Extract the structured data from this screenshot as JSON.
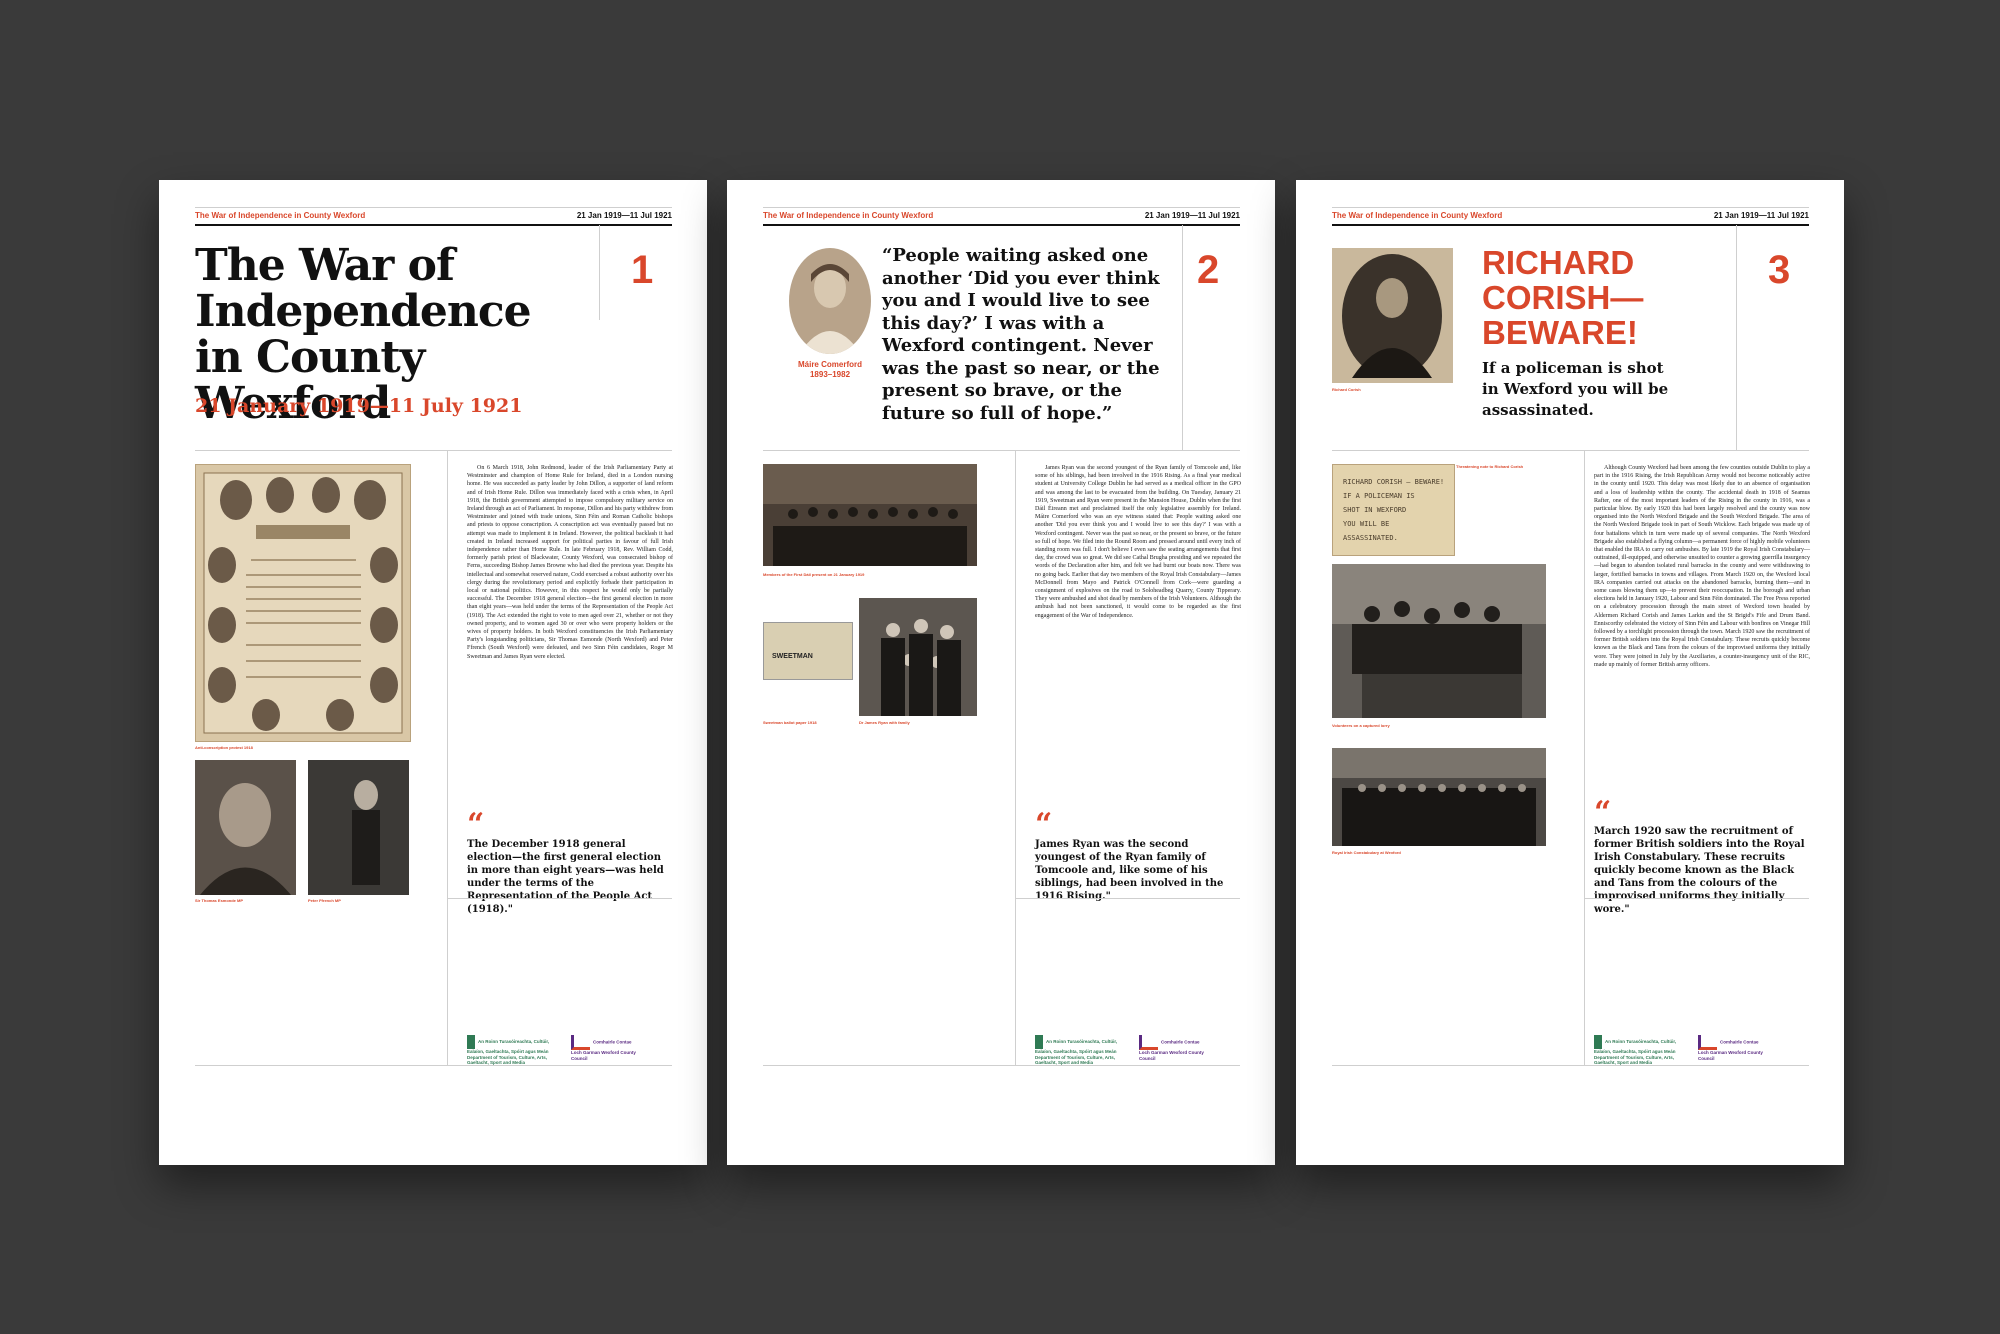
{
  "header": {
    "series_title": "The War of Independence in County Wexford",
    "date_range": "21 Jan 1919—11 Jul 1921"
  },
  "panel1": {
    "number": "1",
    "title": "The War of Independence in County Wexford",
    "subtitle": "21 January 1919—11 July 1921",
    "body": "On 6 March 1918, John Redmond, leader of the Irish Parliamentary Party at Westminster and champion of Home Rule for Ireland, died in a London nursing home. He was succeeded as party leader by John Dillon, a supporter of land reform and of Irish Home Rule. Dillon was immediately faced with a crisis when, in April 1918, the British government attempted to impose compulsory military service on Ireland through an act of Parliament. In response, Dillon and his party withdrew from Westminster and joined with trade unions, Sinn Féin and Roman Catholic bishops and priests to oppose conscription. A conscription act was eventually passed but no attempt was made to implement it in Ireland. However, the political backlash it had created in Ireland increased support for political parties in favour of full Irish independence rather than Home Rule. In late February 1918, Rev. William Codd, formerly parish priest of Blackwater, County Wexford, was consecrated bishop of Ferns, succeeding Bishop James Browne who had died the previous year. Despite his intellectual and somewhat reserved nature, Codd exercised a robust authority over his clergy during the revolutionary period and explicitly forbade their participation in local or national politics. However, in this respect he would only be partially successful. The December 1918 general election—the first general election in more than eight years—was held under the terms of the Representation of the People Act (1918). The Act extended the right to vote to men aged over 21, whether or not they owned property, and to women aged 30 or over who were property holders or the wives of property holders. In both Wexford constituencies the Irish Parliamentary Party's longstanding politicians, Sir Thomas Esmonde (North Wexford) and Peter Ffrench (South Wexford) were defeated, and two Sinn Féin candidates, Roger M Sweetman and James Ryan were elected.",
    "pullquote": "The December 1918 general election—the first general election in more than eight years—was held under the terms of the Representation of the People Act (1918).\"",
    "captions": [
      "Anti-conscription protest 1918",
      "Sir Thomas Esmonde MP",
      "Peter Ffrench MP"
    ]
  },
  "panel2": {
    "number": "2",
    "portrait_name": "Máire Comerford",
    "portrait_years": "1893–1982",
    "quote": "“People waiting asked one another ‘Did you ever think you and I would live to see this day?’ I was with a Wexford contingent. Never was the past so near, or the present so brave, or the future so full of hope.”",
    "body": "James Ryan was the second youngest of the Ryan family of Tomcoole and, like some of his siblings, had been involved in the 1916 Rising. As a final year medical student at University College Dublin he had served as a medical officer in the GPO and was among the last to be evacuated from the building. On Tuesday, January 21 1919, Sweetman and Ryan were present in the Mansion House, Dublin when the first Dáil Éireann met and proclaimed itself the only legislative assembly for Ireland. Máire Comerford who was an eye witness stated that: People waiting asked one another 'Did you ever think you and I would live to see this day?' I was with a Wexford contingent. Never was the past so near, or the present so brave, or the future so full of hope. We filed into the Round Room and pressed around until every inch of standing room was full. I don't believe I even saw the seating arrangements that first day, the crowd was so great. We did see Cathal Brugha presiding and we repeated the words of the Declaration after him, and felt we had burnt our boats now. There was no going back. Earlier that day two members of the Royal Irish Constabulary—James McDonnell from Mayo and Patrick O'Connell from Cork—were guarding a consignment of explosives on the road to Soloheadbeg Quarry, County Tipperary. They were ambushed and shot dead by members of the Irish Volunteers. Although the ambush had not been sanctioned, it would come to be regarded as the first engagement of the War of Independence.",
    "pullquote": "James Ryan was the second youngest of the Ryan family of Tomcoole and, like some of his siblings, had been involved in the 1916 Rising.\"",
    "ballot_text": "SWEETMAN",
    "captions": [
      "Members of the First Dáil present on 21 January 1919",
      "Sweetman ballot paper 1918",
      "Dr James Ryan with family"
    ]
  },
  "panel3": {
    "number": "3",
    "title": "RICHARD CORISH—BEWARE!",
    "subtitle": "If a policeman is shot in Wexford you will be assassinated.",
    "note_lines": [
      "RICHARD CORISH — BEWARE!",
      "IF A POLICEMAN IS",
      "SHOT IN WEXFORD",
      "YOU WILL BE",
      "ASSASSINATED."
    ],
    "body": "Although County Wexford had been among the few counties outside Dublin to play a part in the 1916 Rising, the Irish Republican Army would not become noticeably active in the county until 1920. This delay was most likely due to an absence of organisation and a loss of leadership within the county. The accidental death in 1918 of Seamus Rafter, one of the most important leaders of the Rising in the county in 1916, was a particular blow. By early 1920 this had been largely resolved and the county was now organised into the North Wexford Brigade and the South Wexford Brigade. The area of the North Wexford Brigade took in part of South Wicklow. Each brigade was made up of four battalions which in turn were made up of several companies. The North Wexford Brigade also established a flying column—a permanent force of highly mobile volunteers that enabled the IRA to carry out ambushes. By late 1919 the Royal Irish Constabulary—outtrained, ill-equipped, and otherwise unsuited to counter a growing guerrilla insurgency—had begun to abandon isolated rural barracks in the county and were withdrawing to larger, fortified barracks in towns and villages. From March 1920 on, the Wexford local IRA companies carried out attacks on the abandoned barracks, burning them—and in some cases blowing them up—to prevent their reoccupation. In the borough and urban elections held in January 1920, Labour and Sinn Féin dominated. The Free Press reported on a celebratory procession through the main street of Wexford town headed by Aldermen Richard Corish and James Larkin and the St Brigid's Fife and Drum Band. Enniscorthy celebrated the victory of Sinn Féin and Labour with bonfires on Vinegar Hill followed by a torchlight procession through the town. March 1920 saw the recruitment of former British soldiers into the Royal Irish Constabulary. These recruits quickly become known as the Black and Tans from the colours of the improvised uniforms they initially wore. They were joined in July by the Auxiliaries, a counter-insurgency unit of the RIC, made up mainly of former British army officers.",
    "pullquote": "March 1920 saw the recruitment of former British soldiers into the Royal Irish Constabulary. These recruits quickly become known as the Black and Tans from the colours of the improvised uniforms they initially wore.\"",
    "captions": [
      "Richard Corish",
      "Threatening note to Richard Corish",
      "Volunteers on a captured lorry",
      "Royal Irish Constabulary at Wexford"
    ]
  },
  "logos": {
    "dept": "An Roinn Turasóireachta, Cultúir, Ealaíon, Gaeltachta, Spóirt agus Meán Department of Tourism, Culture, Arts, Gaeltacht, Sport and Media",
    "council": "Comhairle Contae Loch Garman Wexford County Council"
  },
  "colors": {
    "accent": "#d9472b",
    "background": "#3a3a3a",
    "paper": "#ffffff",
    "photo": "#6b5a48"
  },
  "quote_mark": "“"
}
